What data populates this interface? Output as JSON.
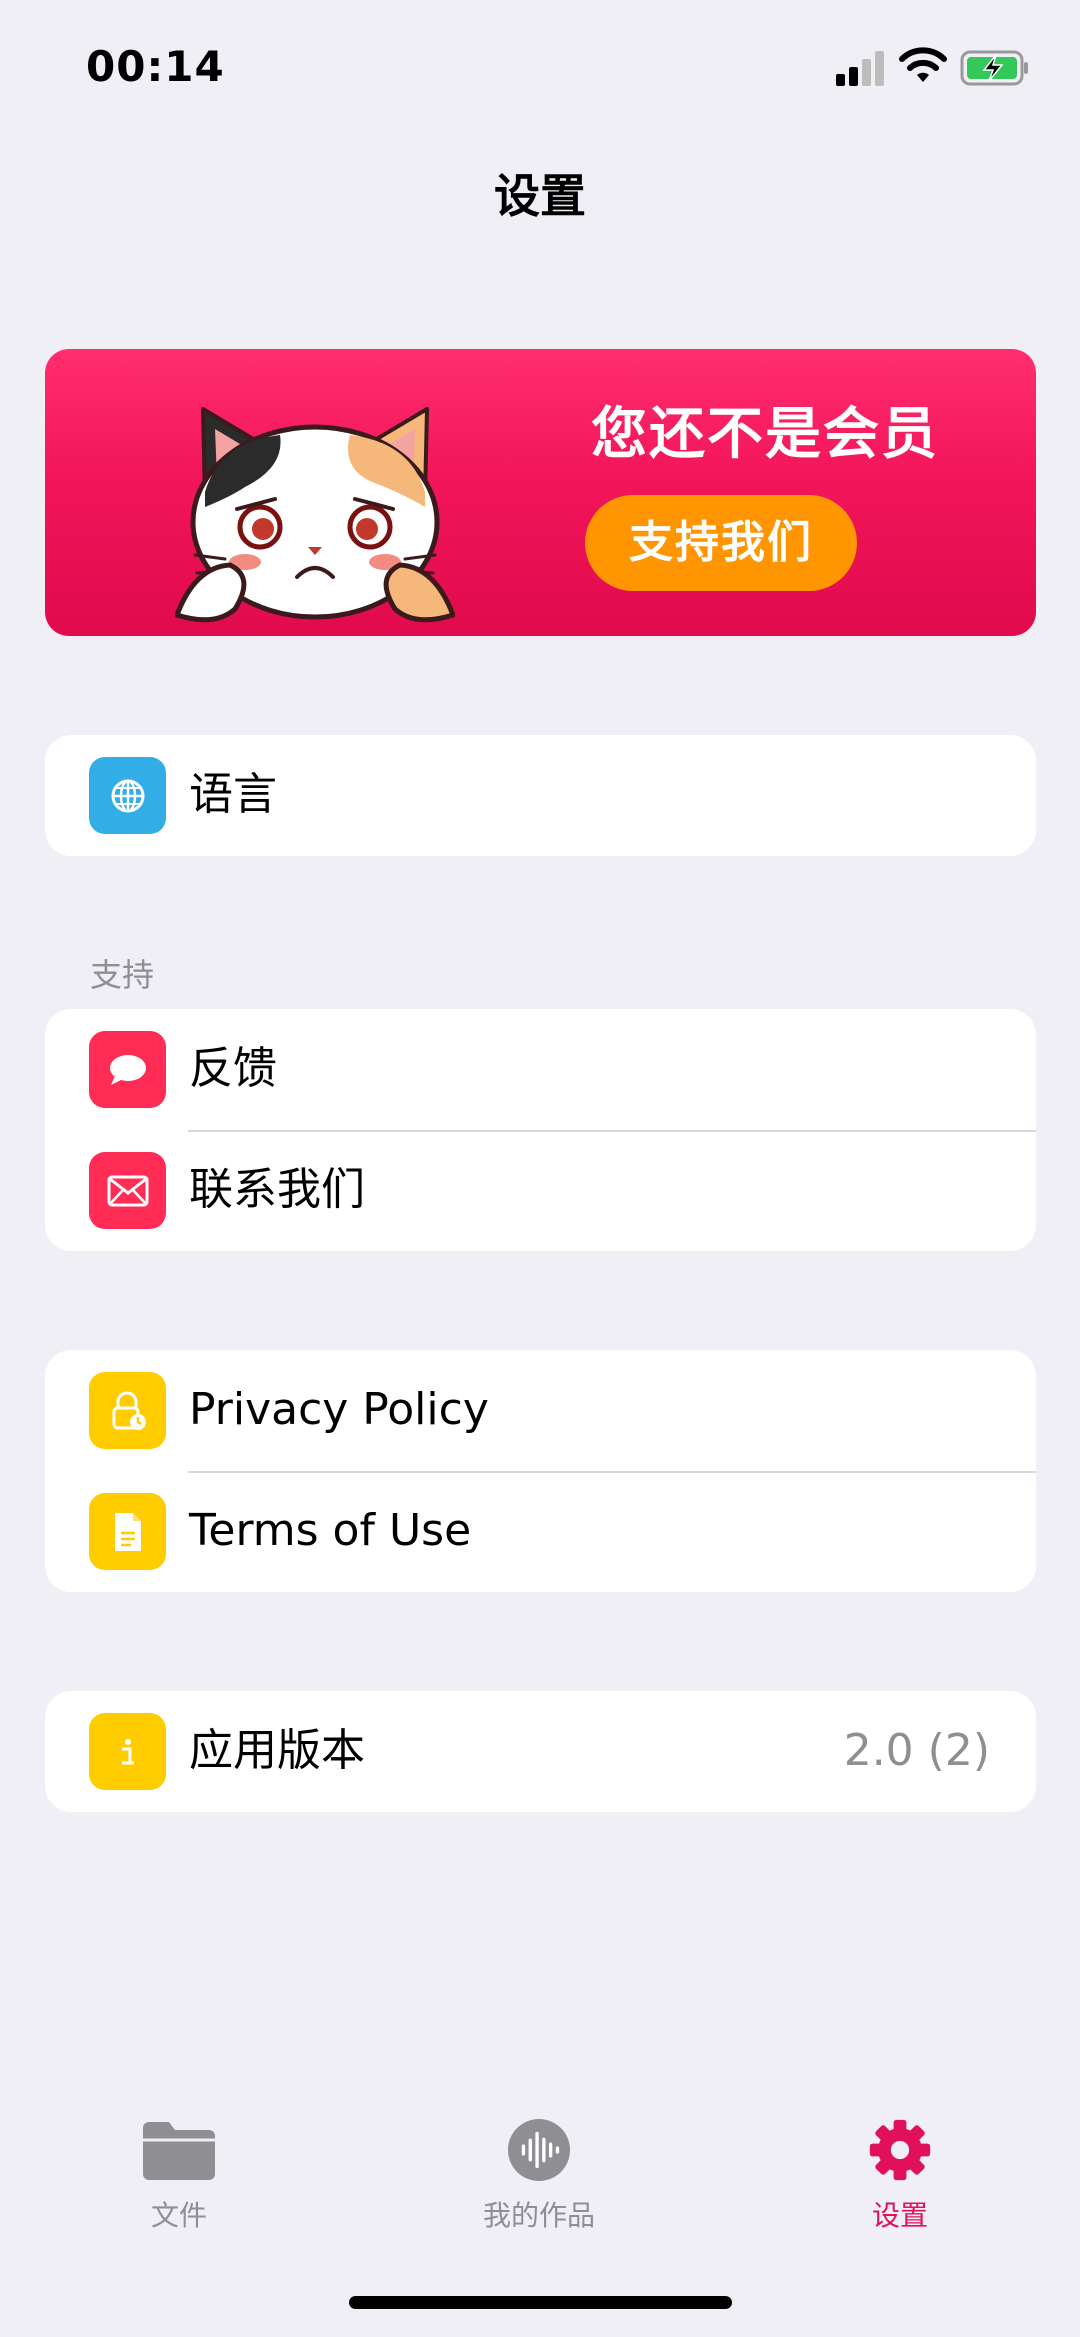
{
  "status_bar": {
    "time": "00:14"
  },
  "page": {
    "title": "设置"
  },
  "banner": {
    "text": "您还不是会员",
    "button_label": "支持我们"
  },
  "language": {
    "label": "语言",
    "icon": "globe-icon"
  },
  "support": {
    "header": "支持",
    "items": [
      {
        "label": "反馈",
        "icon": "chat-bubble-icon"
      },
      {
        "label": "联系我们",
        "icon": "envelope-icon"
      }
    ]
  },
  "legal": {
    "items": [
      {
        "label": "Privacy Policy",
        "icon": "lock-icon"
      },
      {
        "label": "Terms of Use",
        "icon": "document-icon"
      }
    ]
  },
  "about": {
    "label": "应用版本",
    "value": "2.0 (2)",
    "icon": "info-icon"
  },
  "tabs": [
    {
      "label": "文件",
      "icon": "folder-icon",
      "active": false
    },
    {
      "label": "我的作品",
      "icon": "waveform-icon",
      "active": false
    },
    {
      "label": "设置",
      "icon": "gear-icon",
      "active": true
    }
  ],
  "colors": {
    "accent": "#e0105a",
    "banner_button": "#ff9500",
    "blue_icon": "#32ade6",
    "red_icon": "#ff2d55",
    "yellow_icon": "#ffcc00",
    "background": "#f0eff5"
  }
}
